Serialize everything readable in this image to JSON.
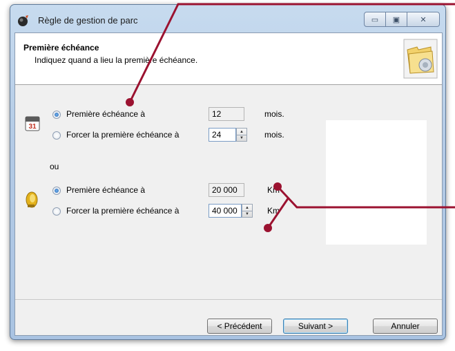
{
  "window": {
    "title": "Règle de gestion de parc",
    "controls": {
      "minimize": "▭",
      "maximize": "▣",
      "close": "✕"
    }
  },
  "header": {
    "title": "Première échéance",
    "subtitle": "Indiquez quand a lieu la première échéance."
  },
  "time_group": {
    "option1": {
      "label": "Première échéance à",
      "value": "12",
      "unit": "mois.",
      "selected": true
    },
    "option2": {
      "label": "Forcer la première échéance à",
      "value": "24",
      "unit": "mois.",
      "selected": false
    }
  },
  "separator_label": "ou",
  "distance_group": {
    "option1": {
      "label": "Première échéance à",
      "value": "20 000",
      "unit": "Km",
      "selected": true
    },
    "option2": {
      "label": "Forcer la première échéance à",
      "value": "40 000",
      "unit": "Km",
      "selected": false
    }
  },
  "buttons": {
    "previous": "< Précédent",
    "next": "Suivant >",
    "cancel": "Annuler"
  },
  "icons": {
    "app": "app-icon",
    "wizard": "folder-gear-icon",
    "calendar": "calendar-icon",
    "gauge": "gauge-icon",
    "calendar_day": "31"
  },
  "colors": {
    "annotation": "#9b1230",
    "selection": "#1f5fb0"
  }
}
